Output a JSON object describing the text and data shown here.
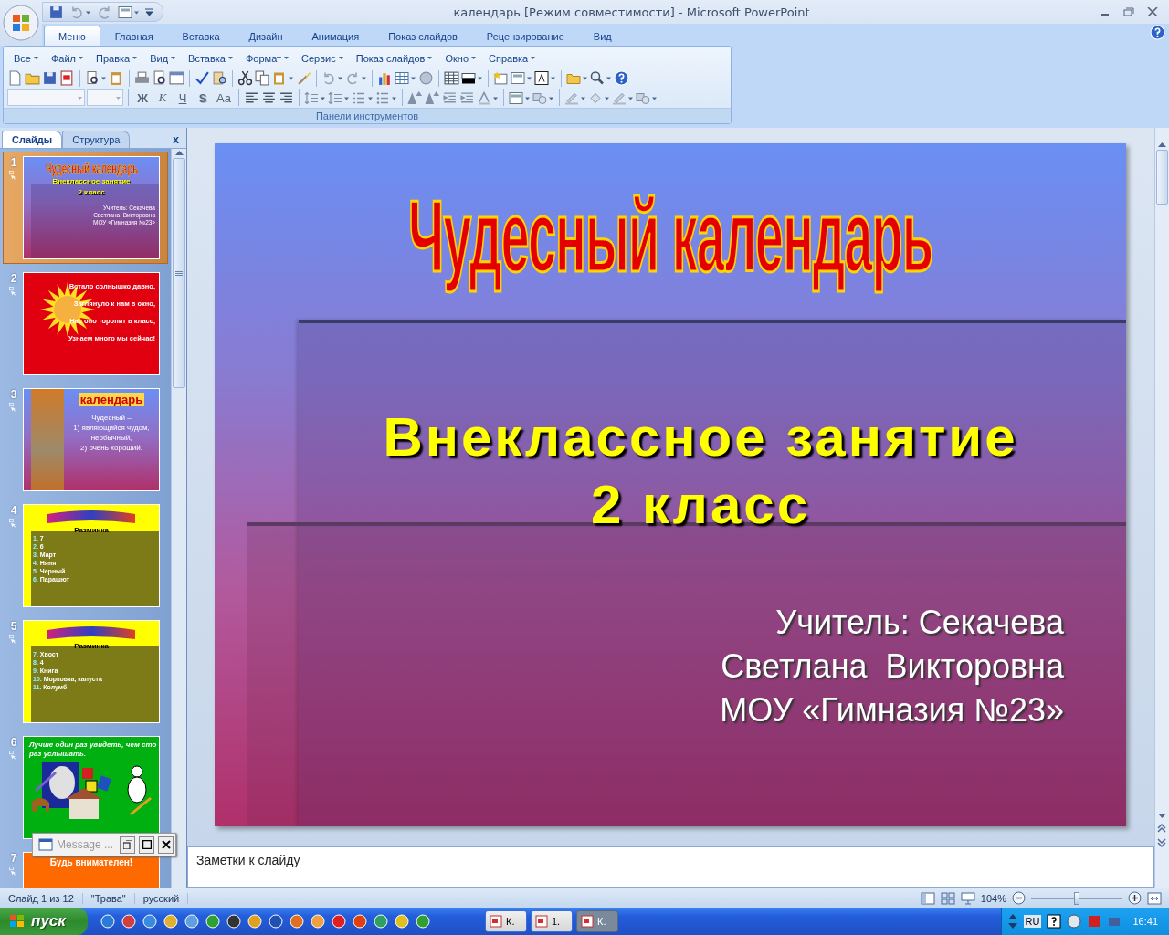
{
  "window": {
    "title": "календарь [Режим совместимости] - Microsoft PowerPoint"
  },
  "ribbon_tabs": [
    {
      "label": "Меню",
      "selected": true
    },
    {
      "label": "Главная",
      "selected": false
    },
    {
      "label": "Вставка",
      "selected": false
    },
    {
      "label": "Дизайн",
      "selected": false
    },
    {
      "label": "Анимация",
      "selected": false
    },
    {
      "label": "Показ слайдов",
      "selected": false
    },
    {
      "label": "Рецензирование",
      "selected": false
    },
    {
      "label": "Вид",
      "selected": false
    }
  ],
  "menu_bar": [
    "Все",
    "Файл",
    "Правка",
    "Вид",
    "Вставка",
    "Формат",
    "Сервис",
    "Показ слайдов",
    "Окно",
    "Справка"
  ],
  "format_buttons": [
    "Ж",
    "К",
    "Ч",
    "S",
    "Aa"
  ],
  "ribbon_group": "Панели инструментов",
  "slide_panel": {
    "tabs": [
      {
        "label": "Слайды",
        "selected": true
      },
      {
        "label": "Структура",
        "selected": false
      }
    ],
    "close": "x",
    "thumbnails": [
      {
        "number": "1",
        "selected": true,
        "kind": "title",
        "title": "Чудесный календарь",
        "subtitle": [
          "Внеклассное занятие",
          "2 класс"
        ],
        "body": [
          "Учитель: Секачева",
          "Светлана  Викторовна",
          "МОУ «Гимназия №23»"
        ]
      },
      {
        "number": "2",
        "selected": false,
        "kind": "poem",
        "lines": [
          "Встало солнышко давно,",
          "Заглянуло к нам в окно,",
          "Нас оно торопит в класс,",
          "Узнаем много мы сейчас!"
        ]
      },
      {
        "number": "3",
        "selected": false,
        "kind": "photo_text",
        "title": "календарь",
        "lines": [
          "Чудесный –",
          "1) являющийся чудом,",
          "необычный,",
          "2) очень хороший."
        ]
      },
      {
        "number": "4",
        "selected": false,
        "kind": "list",
        "heading": "Разминка",
        "items": [
          {
            "number": "1.",
            "text": "7"
          },
          {
            "number": "2.",
            "text": "6"
          },
          {
            "number": "3.",
            "text": "Март"
          },
          {
            "number": "4.",
            "text": "Няня"
          },
          {
            "number": "5.",
            "text": "Черный"
          },
          {
            "number": "6.",
            "text": "Парашют"
          }
        ]
      },
      {
        "number": "5",
        "selected": false,
        "kind": "list",
        "heading": "Разминка",
        "items": [
          {
            "number": "7.",
            "text": "Хвост"
          },
          {
            "number": "8.",
            "text": "4"
          },
          {
            "number": "9.",
            "text": "Книга"
          },
          {
            "number": "10.",
            "text": "Морковка, капуста"
          },
          {
            "number": "11.",
            "text": "Колумб"
          }
        ]
      },
      {
        "number": "6",
        "selected": false,
        "kind": "pictures",
        "caption": "Лучше один раз увидеть, чем сто раз услышать."
      },
      {
        "number": "7",
        "selected": false,
        "kind": "header",
        "title": "Будь внимателен!"
      }
    ]
  },
  "message_window": {
    "title": "Message ..."
  },
  "slide": {
    "title": "Чудесный календарь",
    "subtitle": [
      "Внеклассное занятие",
      "2 класс"
    ],
    "body": [
      "Учитель: Секачева",
      "Светлана  Викторовна",
      "МОУ «Гимназия №23»"
    ]
  },
  "notes": {
    "placeholder": "Заметки к слайду"
  },
  "status_bar": {
    "items": [
      "Слайд 1 из 12",
      "\"Трава\"",
      "русский"
    ],
    "zoom": "104%",
    "zoom_slider": {
      "level": 0.5
    }
  },
  "taskbar": {
    "start": "пуск",
    "tasks": [
      {
        "label": "К.",
        "selected": false
      },
      {
        "label": "1.",
        "selected": false
      },
      {
        "label": "К.",
        "selected": true
      }
    ],
    "language": "RU",
    "clock": "16:41"
  }
}
